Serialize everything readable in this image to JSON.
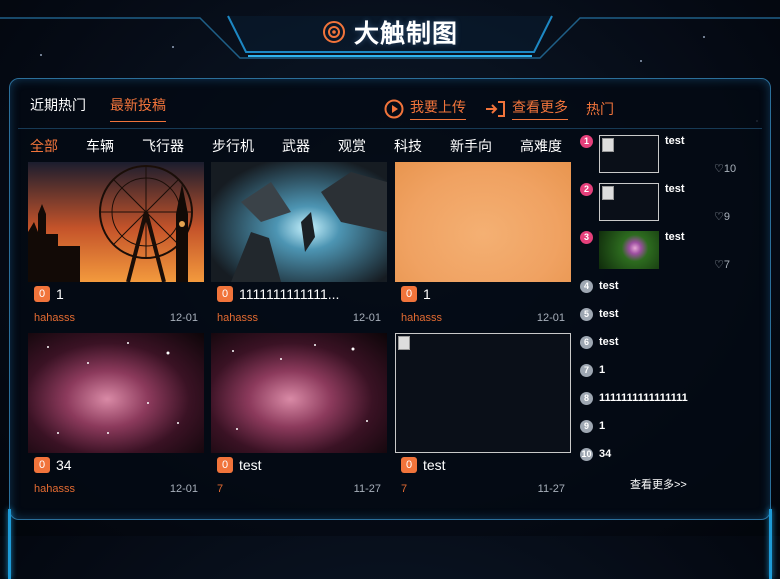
{
  "header": {
    "title": "大触制图"
  },
  "tabs": [
    {
      "label": "近期热门",
      "active": false
    },
    {
      "label": "最新投稿",
      "active": true
    }
  ],
  "actions": {
    "upload": "我要上传",
    "more": "查看更多",
    "hot": "热门"
  },
  "categories": [
    {
      "label": "全部",
      "active": true
    },
    {
      "label": "车辆"
    },
    {
      "label": "飞行器"
    },
    {
      "label": "步行机"
    },
    {
      "label": "武器"
    },
    {
      "label": "观赏"
    },
    {
      "label": "科技"
    },
    {
      "label": "新手向"
    },
    {
      "label": "高难度"
    }
  ],
  "cards": [
    {
      "count": "0",
      "title": "1",
      "author": "hahasss",
      "date": "12-01",
      "image": "london-sunset"
    },
    {
      "count": "0",
      "title": "1111111111111...",
      "author": "hahasss",
      "date": "12-01",
      "image": "battle-scene"
    },
    {
      "count": "0",
      "title": "1",
      "author": "hahasss",
      "date": "12-01",
      "image": "orange-blur"
    },
    {
      "count": "0",
      "title": "34",
      "author": "hahasss",
      "date": "12-01",
      "image": "nebula"
    },
    {
      "count": "0",
      "title": "test",
      "author": "7",
      "date": "11-27",
      "image": "nebula"
    },
    {
      "count": "0",
      "title": "test",
      "author": "7",
      "date": "11-27",
      "image": "broken"
    }
  ],
  "sidebar": {
    "items": [
      {
        "rank": "1",
        "title": "test",
        "likes": "10",
        "image": "broken"
      },
      {
        "rank": "2",
        "title": "test",
        "likes": "9",
        "image": "broken"
      },
      {
        "rank": "3",
        "title": "test",
        "likes": "7",
        "image": "flower"
      },
      {
        "rank": "4",
        "title": "test"
      },
      {
        "rank": "5",
        "title": "test"
      },
      {
        "rank": "6",
        "title": "test"
      },
      {
        "rank": "7",
        "title": "1"
      },
      {
        "rank": "8",
        "title": "1111111111111111"
      },
      {
        "rank": "9",
        "title": "1"
      },
      {
        "rank": "10",
        "title": "34"
      }
    ],
    "more_label": "查看更多>>"
  },
  "colors": {
    "accent": "#f1743b",
    "hot_rank": "#e5407b",
    "frame": "#2b6f9a"
  }
}
